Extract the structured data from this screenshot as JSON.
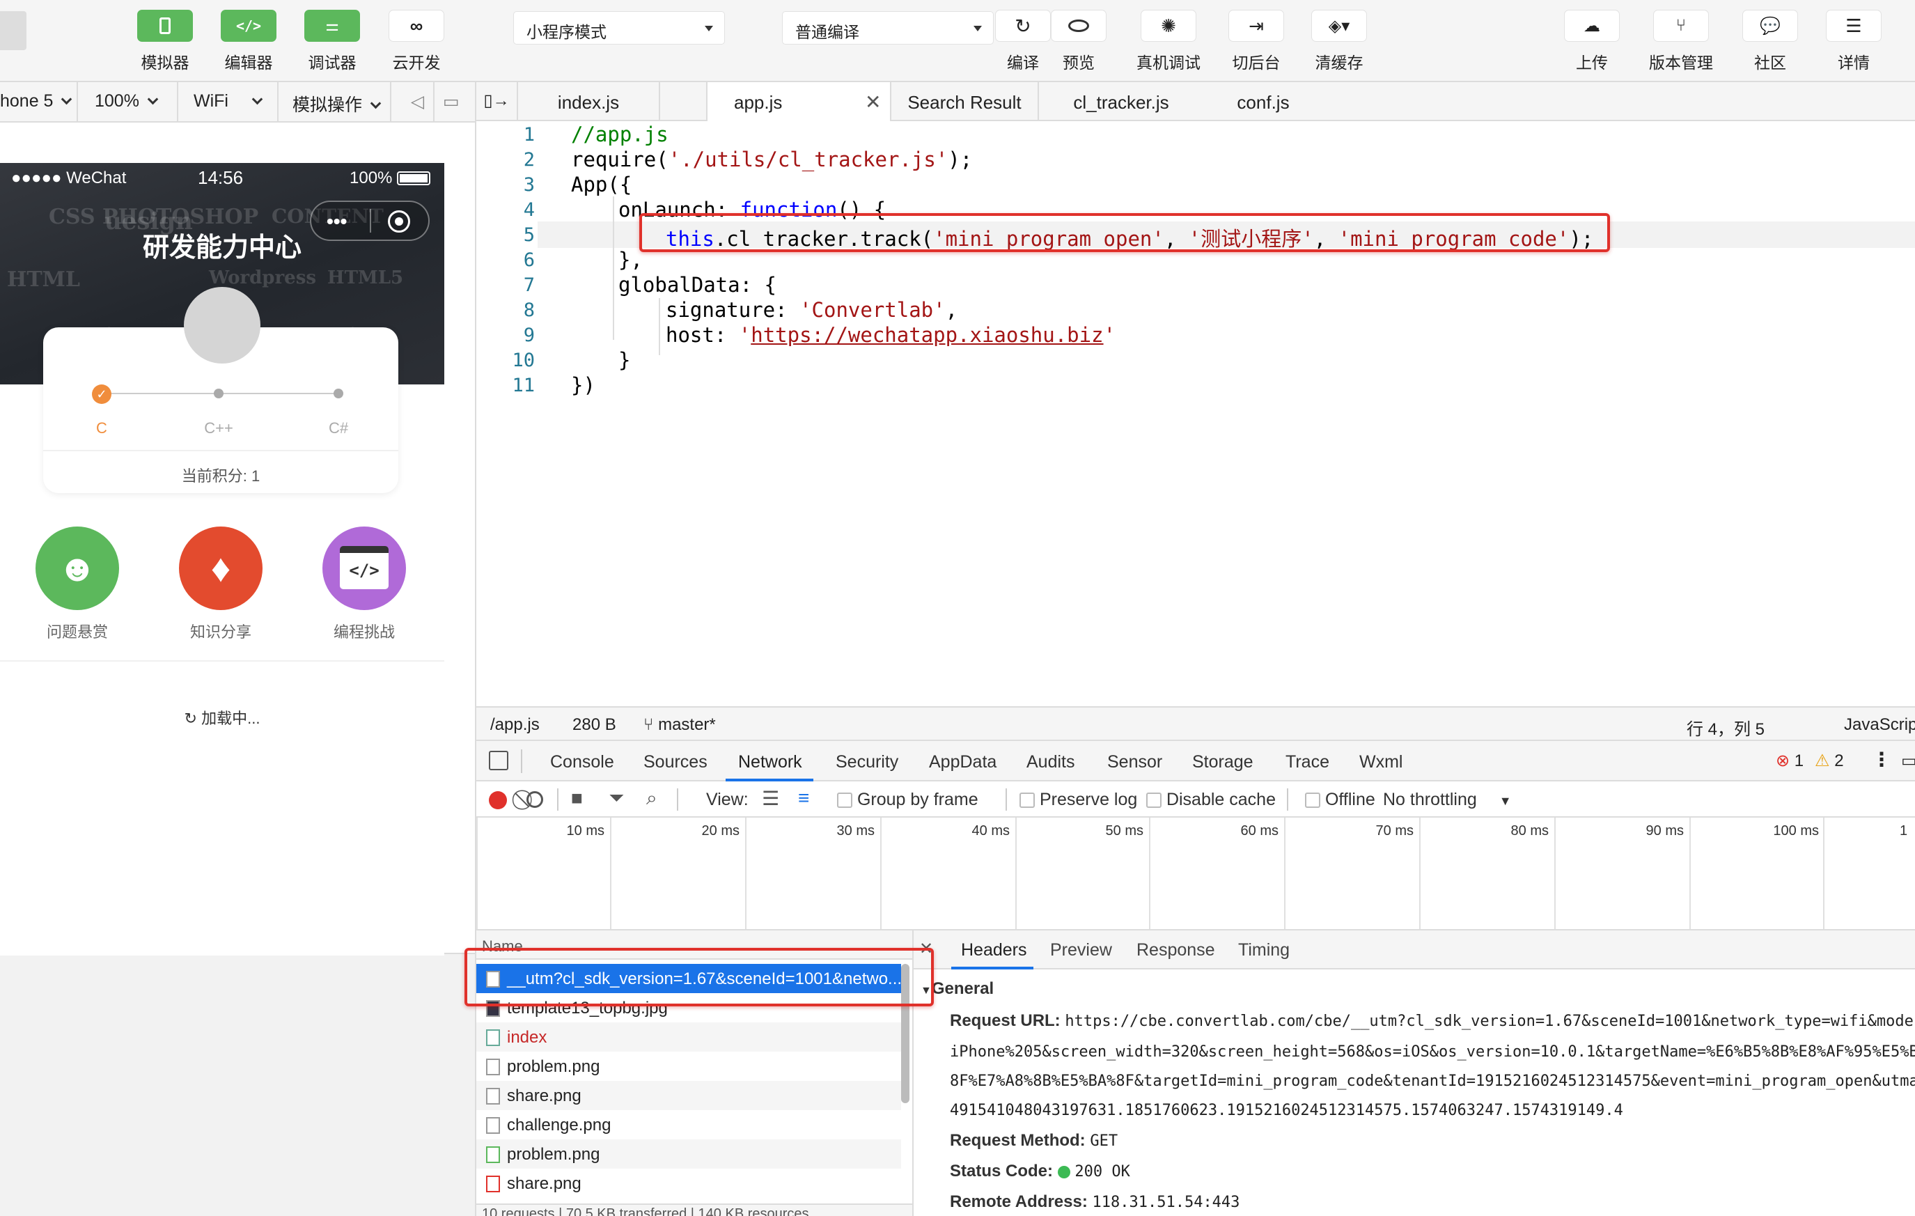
{
  "toolbar": {
    "left_buttons": [
      {
        "label": "模拟器",
        "icon": "phone-icon"
      },
      {
        "label": "编辑器",
        "icon": "code-icon"
      },
      {
        "label": "调试器",
        "icon": "sliders-icon"
      },
      {
        "label": "云开发",
        "icon": "cloud-link-icon"
      }
    ],
    "mode_select": "小程序模式",
    "compile_select": "普通编译",
    "mid_buttons": [
      {
        "label": "编译",
        "icon": "refresh-icon"
      },
      {
        "label": "预览",
        "icon": "eye-icon"
      },
      {
        "label": "真机调试",
        "icon": "bug-icon"
      },
      {
        "label": "切后台",
        "icon": "switch-icon"
      },
      {
        "label": "清缓存",
        "icon": "layers-icon"
      }
    ],
    "right_buttons": [
      {
        "label": "上传",
        "icon": "upload-icon"
      },
      {
        "label": "版本管理",
        "icon": "branch-icon"
      },
      {
        "label": "社区",
        "icon": "chat-icon"
      },
      {
        "label": "详情",
        "icon": "menu-icon"
      }
    ]
  },
  "simbar": {
    "device": "hone 5",
    "zoom": "100%",
    "network": "WiFi",
    "ops": "模拟操作"
  },
  "phone": {
    "carrier": "●●●●● WeChat",
    "time": "14:56",
    "battery": "100%",
    "title": "研发能力中心",
    "steps": [
      "C",
      "C++",
      "C#"
    ],
    "score": "当前积分: 1",
    "features": [
      {
        "label": "问题悬赏",
        "color": "#5cb85c"
      },
      {
        "label": "知识分享",
        "color": "#e34b2e"
      },
      {
        "label": "编程挑战",
        "color": "#b06ad8"
      }
    ],
    "loading": "加载中..."
  },
  "editor": {
    "tabs": [
      "index.js",
      "app.js",
      "Search Result",
      "cl_tracker.js",
      "conf.js"
    ],
    "active_tab": "app.js",
    "line_numbers": [
      "1",
      "2",
      "3",
      "4",
      "5",
      "6",
      "7",
      "8",
      "9",
      "10",
      "11"
    ],
    "code": {
      "l1": "//app.js",
      "l2a": "require(",
      "l2b": "'./utils/cl_tracker.js'",
      "l2c": ");",
      "l3": "App({",
      "l4a": "onLaunch: ",
      "l4b": "function",
      "l4c": "() {",
      "l5a": "this",
      "l5b": ".cl_tracker.track(",
      "l5c": "'mini_program_open'",
      "l5d": ", ",
      "l5e": "'测试小程序'",
      "l5f": ", ",
      "l5g": "'mini_program_code'",
      "l5h": ");",
      "l6": "},",
      "l7": "globalData: {",
      "l8a": "signature: ",
      "l8b": "'Convertlab'",
      "l8c": ",",
      "l9a": "host: ",
      "l9b": "'",
      "l9c": "https://wechatapp.xiaoshu.biz",
      "l9d": "'",
      "l10": "}",
      "l11": "})"
    }
  },
  "status": {
    "file": "/app.js",
    "size": "280 B",
    "branch": "master*",
    "position": "行 4，列 5",
    "lang": "JavaScrip"
  },
  "devtools": {
    "tabs": [
      "Console",
      "Sources",
      "Network",
      "Security",
      "AppData",
      "Audits",
      "Sensor",
      "Storage",
      "Trace",
      "Wxml"
    ],
    "active_tab": "Network",
    "errors": "1",
    "warnings": "2",
    "net": {
      "view": "View:",
      "group": "Group by frame",
      "preserve": "Preserve log",
      "disable_cache": "Disable cache",
      "offline": "Offline",
      "throttling": "No throttling"
    },
    "timeline_labels": [
      "10 ms",
      "20 ms",
      "30 ms",
      "40 ms",
      "50 ms",
      "60 ms",
      "70 ms",
      "80 ms",
      "90 ms",
      "100 ms",
      "1"
    ],
    "list_header": "Name",
    "requests": [
      {
        "name": "__utm?cl_sdk_version=1.67&sceneId=1001&netwo...",
        "selected": true
      },
      {
        "name": "template13_topbg.jpg"
      },
      {
        "name": "index",
        "error": true
      },
      {
        "name": "problem.png"
      },
      {
        "name": "share.png"
      },
      {
        "name": "challenge.png"
      },
      {
        "name": "problem.png"
      },
      {
        "name": "share.png"
      }
    ],
    "summary": "10 requests | 70.5 KB transferred | 140 KB resources",
    "detail_tabs": [
      "Headers",
      "Preview",
      "Response",
      "Timing"
    ],
    "general_title": "General",
    "request_url_label": "Request URL:",
    "request_url_lines": [
      "https://cbe.convertlab.com/cbe/__utm?cl_sdk_version=1.67&sceneId=1001&network_type=wifi&mode",
      "iPhone%205&screen_width=320&screen_height=568&os=iOS&os_version=10.0.1&targetName=%E6%B5%8B%E8%AF%95%E5%B",
      "8F%E7%A8%8B%E5%BA%8F&targetId=mini_program_code&tenantId=1915216024512314575&event=mini_program_open&utma",
      "491541048043197631.1851760623.1915216024512314575.1574063247.1574319149.4"
    ],
    "method_label": "Request Method:",
    "method": "GET",
    "status_label": "Status Code:",
    "status_code": "200 OK",
    "remote_label": "Remote Address:",
    "remote": "118.31.51.54:443"
  }
}
